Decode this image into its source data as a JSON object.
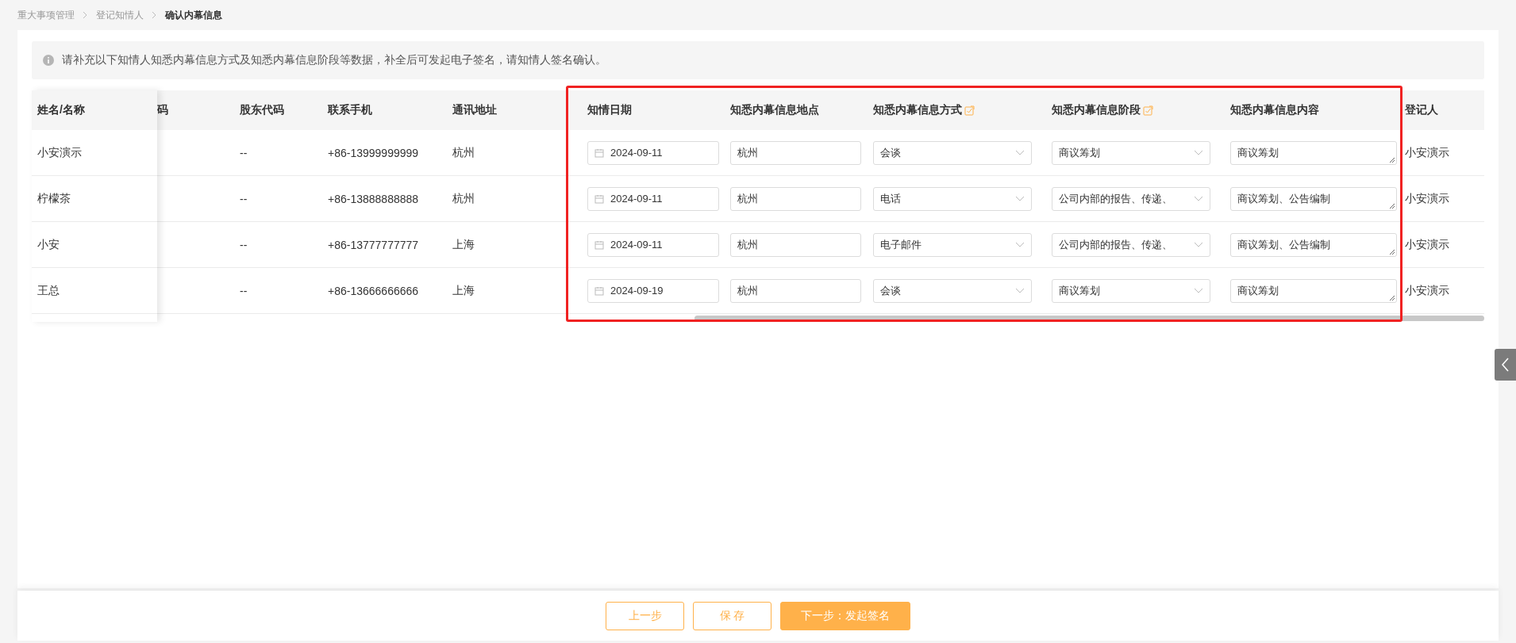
{
  "breadcrumb": [
    {
      "label": "重大事项管理",
      "selected": false
    },
    {
      "label": "登记知情人",
      "selected": false
    },
    {
      "label": "确认内幕信息",
      "selected": true
    }
  ],
  "notice": "请补充以下知情人知悉内幕信息方式及知悉内幕信息阶段等数据，补全后可发起电子签名，请知情人签名确认。",
  "table": {
    "columns": [
      {
        "label": "姓名/名称",
        "editable": false
      },
      {
        "label": "码",
        "editable": false
      },
      {
        "label": "股东代码",
        "editable": false
      },
      {
        "label": "联系手机",
        "editable": false
      },
      {
        "label": "通讯地址",
        "editable": false
      },
      {
        "label": "知情日期",
        "editable": false
      },
      {
        "label": "知悉内幕信息地点",
        "editable": false
      },
      {
        "label": "知悉内幕信息方式",
        "editable": true
      },
      {
        "label": "知悉内幕信息阶段",
        "editable": true
      },
      {
        "label": "知悉内幕信息内容",
        "editable": false
      },
      {
        "label": "登记人",
        "editable": false
      }
    ],
    "rows": [
      {
        "name": "小安演示",
        "shareholder_code": "--",
        "phone": "+86-13999999999",
        "address": "杭州",
        "date": "2024-09-11",
        "place": "杭州",
        "method": "会谈",
        "stage": "商议筹划",
        "content": "商议筹划",
        "registrant": "小安演示"
      },
      {
        "name": "柠檬茶",
        "shareholder_code": "--",
        "phone": "+86-13888888888",
        "address": "杭州",
        "date": "2024-09-11",
        "place": "杭州",
        "method": "电话",
        "stage": "公司内部的报告、传递、",
        "content": "商议筹划、公告编制",
        "registrant": "小安演示"
      },
      {
        "name": "小安",
        "shareholder_code": "--",
        "phone": "+86-13777777777",
        "address": "上海",
        "date": "2024-09-11",
        "place": "杭州",
        "method": "电子邮件",
        "stage": "公司内部的报告、传递、",
        "content": "商议筹划、公告编制",
        "registrant": "小安演示"
      },
      {
        "name": "王总",
        "shareholder_code": "--",
        "phone": "+86-13666666666",
        "address": "上海",
        "date": "2024-09-19",
        "place": "杭州",
        "method": "会谈",
        "stage": "商议筹划",
        "content": "商议筹划",
        "registrant": "小安演示"
      }
    ]
  },
  "buttons": [
    {
      "label": "上一步",
      "kind": "outline"
    },
    {
      "label": "保 存",
      "kind": "outline"
    },
    {
      "label": "下一步：发起签名",
      "kind": "primary"
    }
  ]
}
